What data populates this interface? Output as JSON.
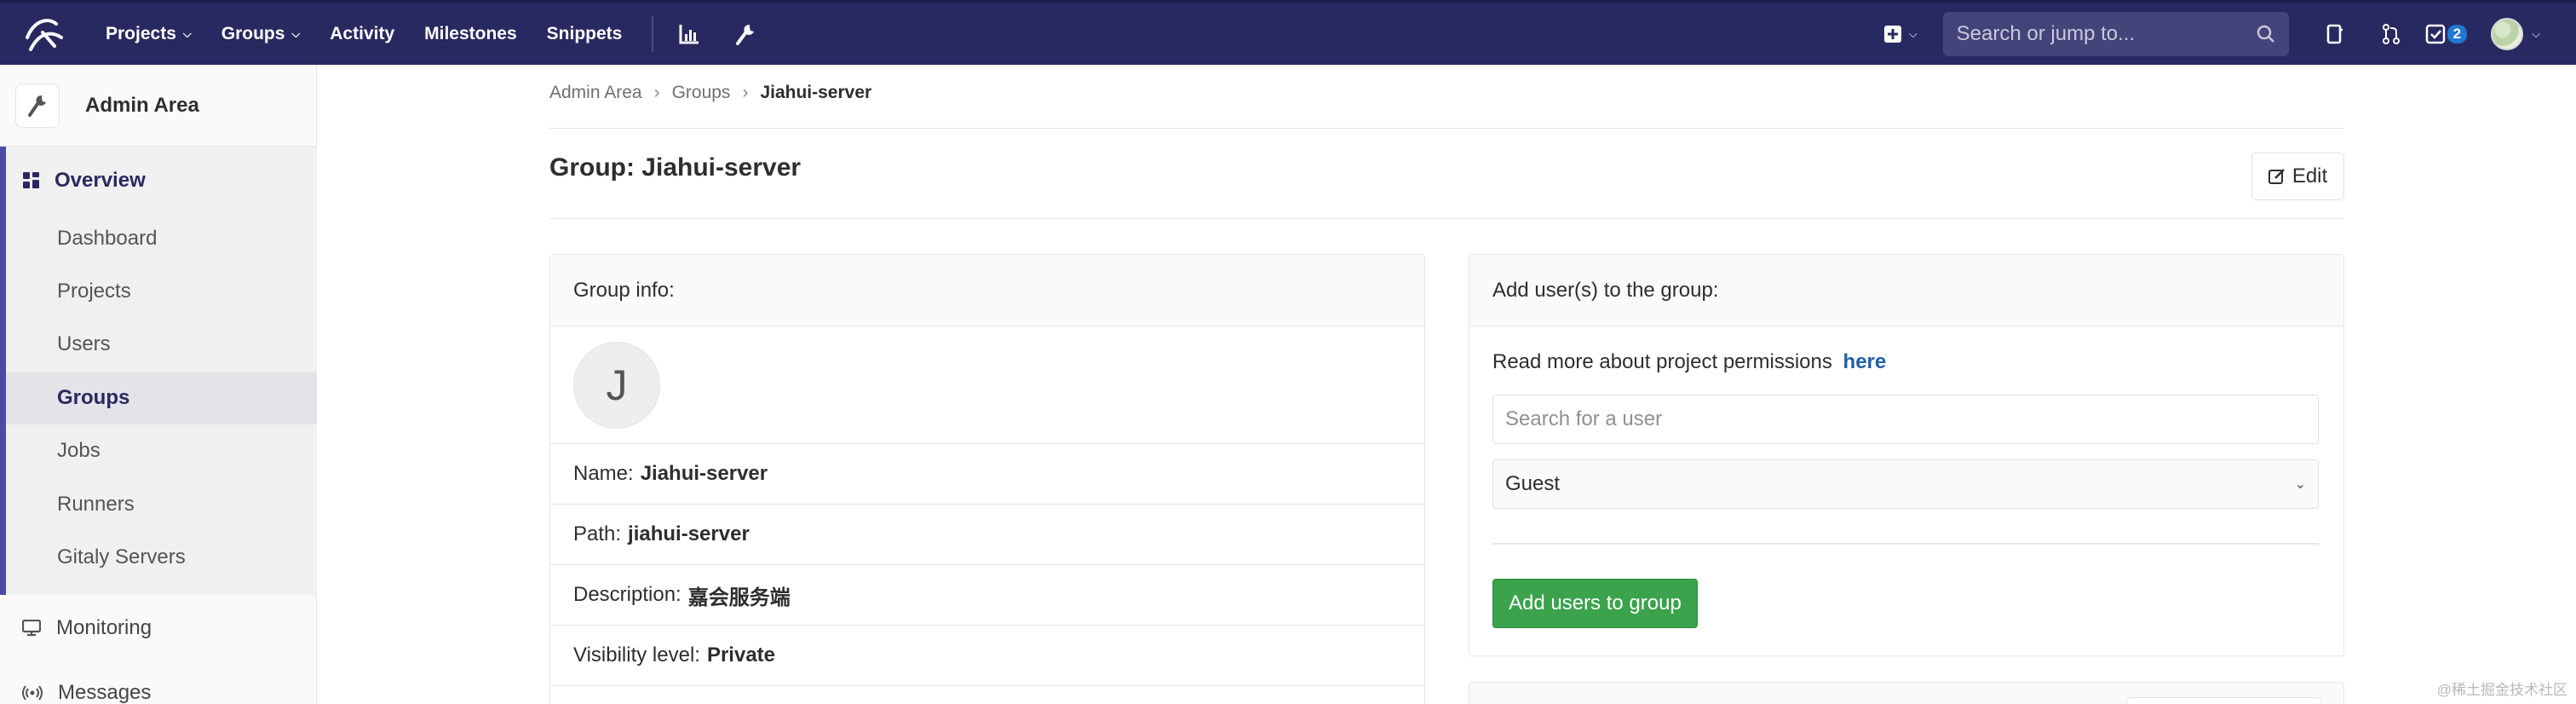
{
  "nav": {
    "links": [
      {
        "label": "Projects",
        "caret": true
      },
      {
        "label": "Groups",
        "caret": true
      },
      {
        "label": "Activity",
        "caret": false
      },
      {
        "label": "Milestones",
        "caret": false
      },
      {
        "label": "Snippets",
        "caret": false
      }
    ],
    "search_placeholder": "Search or jump to...",
    "todo_count": "2"
  },
  "sidebar": {
    "title": "Admin Area",
    "overview": "Overview",
    "sub_items": [
      "Dashboard",
      "Projects",
      "Users",
      "Groups",
      "Jobs",
      "Runners",
      "Gitaly Servers"
    ],
    "active_sub": "Groups",
    "monitoring": "Monitoring",
    "messages": "Messages"
  },
  "breadcrumb": [
    "Admin Area",
    "Groups",
    "Jiahui-server"
  ],
  "page_title": "Group: Jiahui-server",
  "edit_label": "Edit",
  "group_info": {
    "header": "Group info:",
    "avatar_letter": "J",
    "name_label": "Name:",
    "name_value": "Jiahui-server",
    "path_label": "Path:",
    "path_value": "jiahui-server",
    "description_label": "Description:",
    "description_value": "嘉会服务端",
    "visibility_label": "Visibility level:",
    "visibility_value": "Private"
  },
  "add_users": {
    "header": "Add user(s) to the group:",
    "permissions_text": "Read more about project permissions",
    "permissions_link": "here",
    "search_placeholder": "Search for a user",
    "role_value": "Guest",
    "submit_label": "Add users to group"
  },
  "watermark": "@稀土掘金技术社区",
  "colors": {
    "navbar": "#292961",
    "sidebar_accent": "#4b4ba3",
    "link": "#1f5fa8",
    "success_button": "#3aa34b",
    "badge": "#1f78d1"
  }
}
